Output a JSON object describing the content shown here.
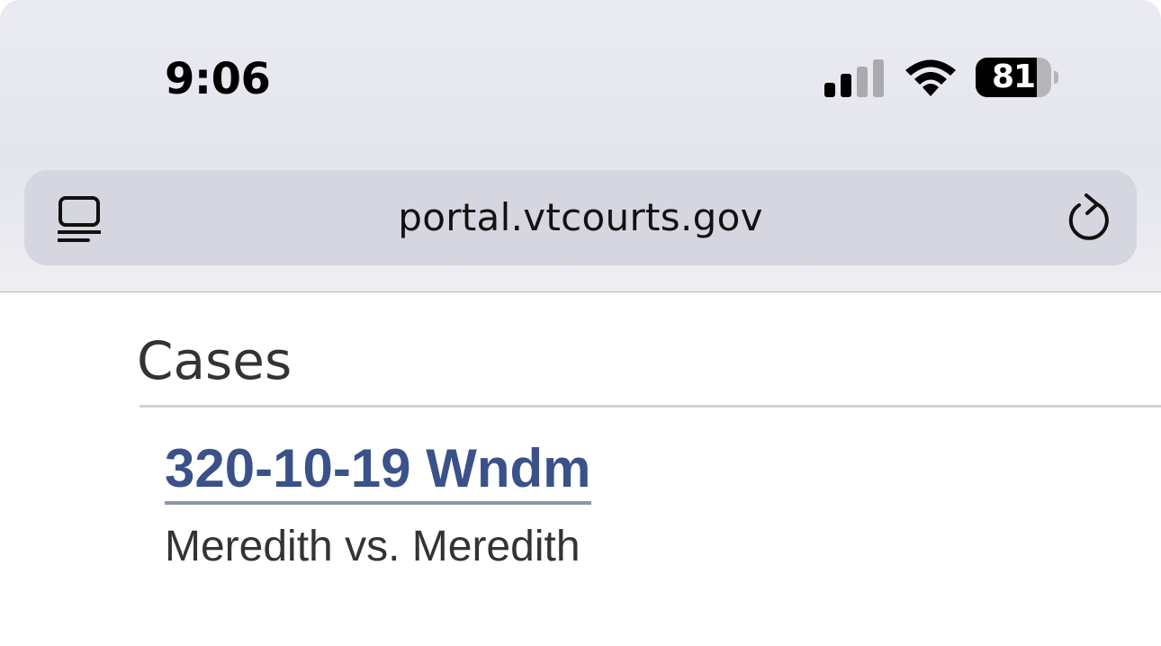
{
  "status_bar": {
    "time": "9:06",
    "signal_icon": "cellular-signal-icon",
    "signal_bars_active": 2,
    "signal_bars_total": 4,
    "wifi_icon": "wifi-icon",
    "battery_icon": "battery-icon",
    "battery_level": "81"
  },
  "address_bar": {
    "reader_icon": "reader-mode-icon",
    "url": "portal.vtcourts.gov",
    "reload_icon": "reload-icon"
  },
  "page": {
    "heading": "Cases",
    "cases": [
      {
        "link_text": "320-10-19 Wndm",
        "title": "Meredith vs. Meredith"
      }
    ]
  },
  "colors": {
    "link": "#3a5189",
    "text": "#333333",
    "chrome_bg": "#e4e5ee",
    "address_bar_bg": "#d5d6df"
  }
}
